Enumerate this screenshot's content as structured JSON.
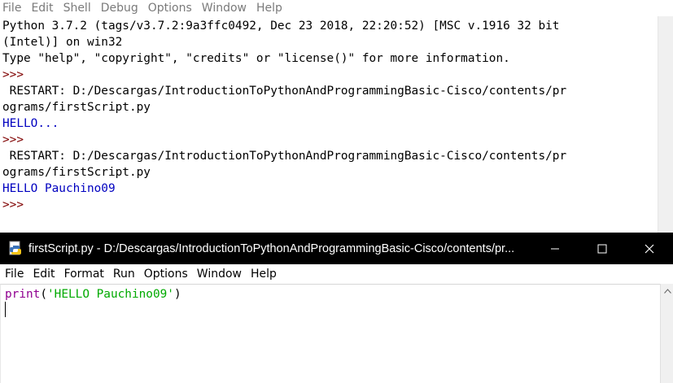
{
  "shell": {
    "menu": [
      "File",
      "Edit",
      "Shell",
      "Debug",
      "Options",
      "Window",
      "Help"
    ],
    "lines": [
      {
        "text": "Python 3.7.2 (tags/v3.7.2:9a3ffc0492, Dec 23 2018, 22:20:52) [MSC v.1916 32 bit",
        "kind": "normal"
      },
      {
        "text": "(Intel)] on win32",
        "kind": "normal"
      },
      {
        "text": "Type \"help\", \"copyright\", \"credits\" or \"license()\" for more information.",
        "kind": "normal"
      },
      {
        "text": ">>>",
        "kind": "prompt"
      },
      {
        "text": " RESTART: D:/Descargas/IntroductionToPythonAndProgrammingBasic-Cisco/contents/pr",
        "kind": "normal"
      },
      {
        "text": "ograms/firstScript.py",
        "kind": "normal"
      },
      {
        "text": "HELLO...",
        "kind": "output"
      },
      {
        "text": ">>>",
        "kind": "prompt"
      },
      {
        "text": " RESTART: D:/Descargas/IntroductionToPythonAndProgrammingBasic-Cisco/contents/pr",
        "kind": "normal"
      },
      {
        "text": "ograms/firstScript.py",
        "kind": "normal"
      },
      {
        "text": "HELLO Pauchino09",
        "kind": "output"
      },
      {
        "text": ">>>",
        "kind": "prompt"
      }
    ]
  },
  "editor": {
    "title": "firstScript.py - D:/Descargas/IntroductionToPythonAndProgrammingBasic-Cisco/contents/pr...",
    "icons": {
      "title_icon": "python-file-icon",
      "minimize": "minimize-icon",
      "maximize": "maximize-icon",
      "close": "close-icon"
    },
    "menu": [
      "File",
      "Edit",
      "Format",
      "Run",
      "Options",
      "Window",
      "Help"
    ],
    "code": {
      "builtin": "print",
      "open_paren": "(",
      "string": "'HELLO Pauchino09'",
      "close_paren": ")"
    }
  },
  "colors": {
    "shell_prompt": "#7f0000",
    "shell_output": "#0000c0",
    "builtin": "#900090",
    "string": "#00aa00",
    "titlebar_bg": "#000000"
  }
}
